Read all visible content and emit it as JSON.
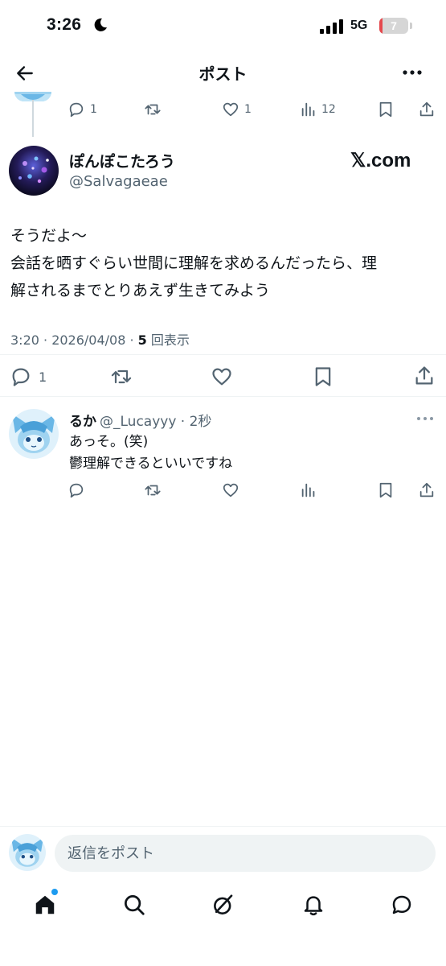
{
  "status_bar": {
    "time": "3:26",
    "network": "5G",
    "battery": "7",
    "battery_level": 0.07
  },
  "header": {
    "title": "ポスト"
  },
  "parent_actions": {
    "replies": "1",
    "likes": "1",
    "views": "12"
  },
  "post": {
    "display_name": "ぽんぽこたろう",
    "handle": "@Salvagaeae",
    "badge": "𝕏.com",
    "text_lines": [
      "そうだよ〜",
      "会話を晒すぐらい世間に理解を求めるんだったら、理",
      "解されるまでとりあえず生きてみよう"
    ],
    "time_date": "3:20 · 2026/04/08 · ",
    "views": "5",
    "views_label": "回表示",
    "replies": "1"
  },
  "reply": {
    "display_name": "るか",
    "handle": "@_Lucayyy · 2秒",
    "text_lines": [
      "あっそ。(笑)",
      "鬱理解できるといいですね"
    ]
  },
  "composer": {
    "placeholder": "返信をポスト"
  },
  "tabs": [
    "home-icon",
    "search-icon",
    "grok-icon",
    "notifications-icon",
    "messages-icon"
  ]
}
